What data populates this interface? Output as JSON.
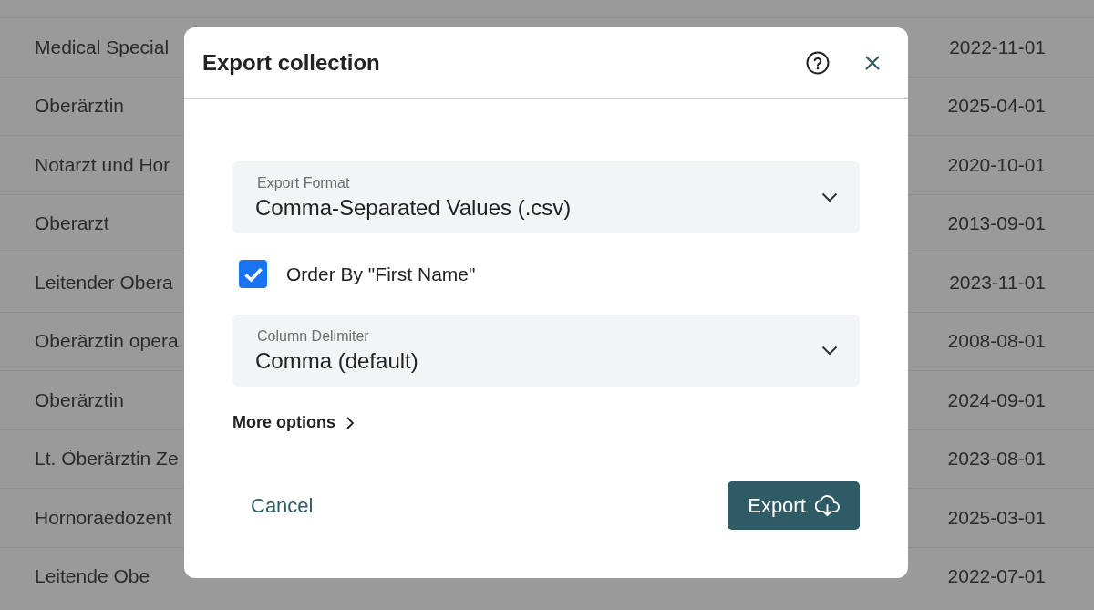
{
  "table": {
    "rows": [
      {
        "title": "Medical Special",
        "date": "2022-11-01"
      },
      {
        "title": "Oberärztin",
        "date": "2025-04-01"
      },
      {
        "title": "Notarzt und Hor",
        "date": "2020-10-01"
      },
      {
        "title": "Oberarzt",
        "date": "2013-09-01"
      },
      {
        "title": "Leitender Obera",
        "date": "2023-11-01"
      },
      {
        "title": "Oberärztin opera",
        "date": "2008-08-01"
      },
      {
        "title": "Oberärztin",
        "date": "2024-09-01"
      },
      {
        "title": "Lt. Öberärztin Ze",
        "date": "2023-08-01"
      },
      {
        "title": "Hornoraedozent",
        "date": "2025-03-01"
      },
      {
        "title": "Leitende Obe",
        "date": "2022-07-01"
      }
    ]
  },
  "dialog": {
    "title": "Export collection",
    "fields": [
      {
        "label": "Export Format",
        "value": "Comma-Separated Values (.csv)"
      }
    ],
    "checkbox": {
      "label": "Order By \"First Name\"",
      "checked": true
    },
    "fields_2": [
      {
        "label": "Column Delimiter",
        "value": "Comma (default)"
      }
    ],
    "more_options": "More options",
    "cancel": "Cancel",
    "export": "Export"
  }
}
